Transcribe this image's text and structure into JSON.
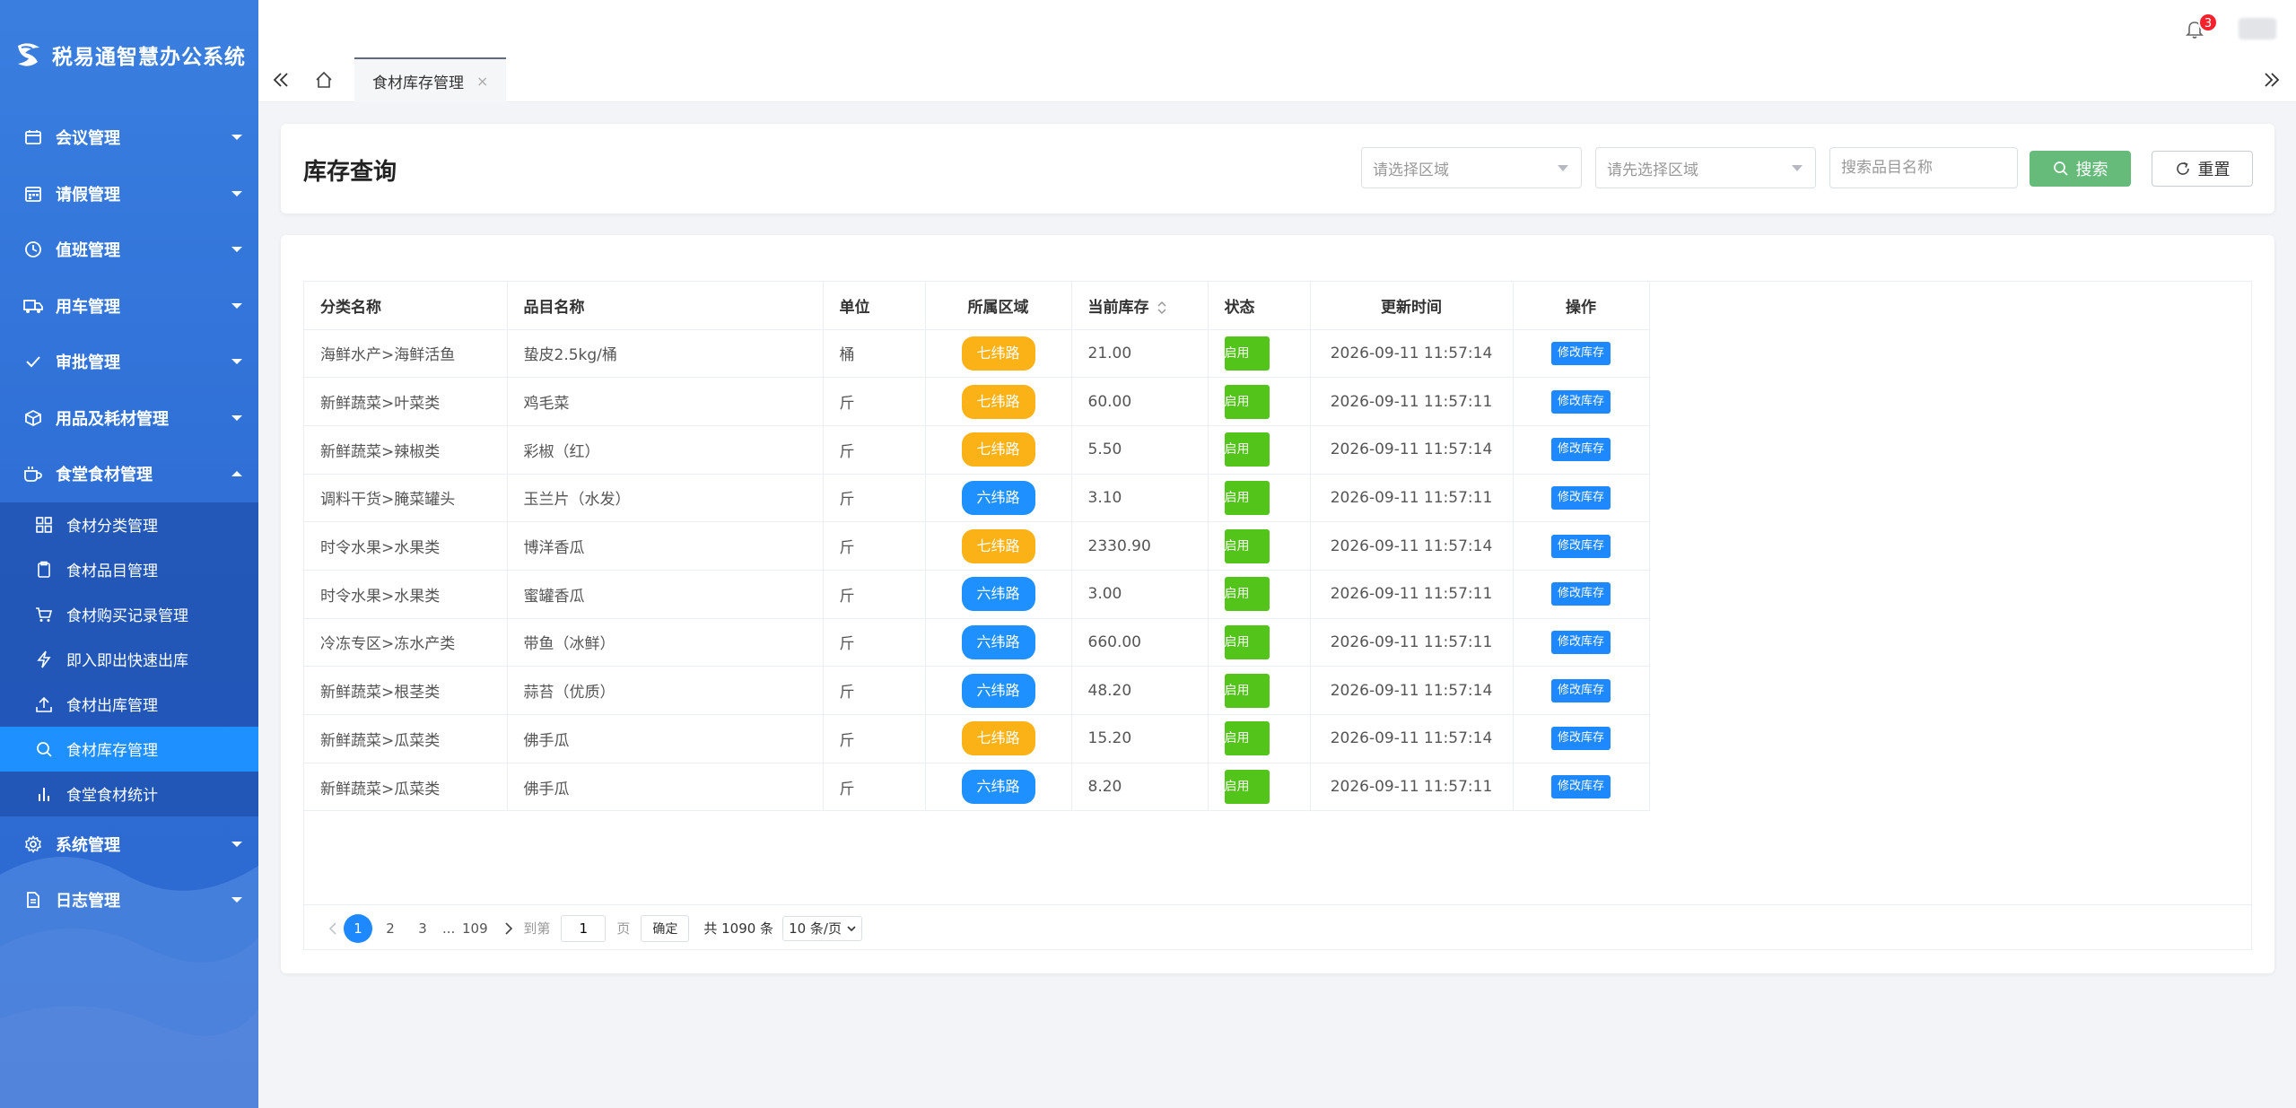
{
  "app": {
    "title": "税易通智慧办公系统"
  },
  "sidebar": {
    "menu": [
      {
        "label": "会议管理",
        "icon": "calendar-icon"
      },
      {
        "label": "请假管理",
        "icon": "calendar-grid-icon"
      },
      {
        "label": "值班管理",
        "icon": "clock-icon"
      },
      {
        "label": "用车管理",
        "icon": "truck-icon"
      },
      {
        "label": "审批管理",
        "icon": "check-icon"
      },
      {
        "label": "用品及耗材管理",
        "icon": "box-icon"
      },
      {
        "label": "食堂食材管理",
        "icon": "cup-icon"
      }
    ],
    "submenu": [
      {
        "label": "食材分类管理",
        "icon": "grid-icon"
      },
      {
        "label": "食材品目管理",
        "icon": "clipboard-icon"
      },
      {
        "label": "食材购买记录管理",
        "icon": "cart-icon"
      },
      {
        "label": "即入即出快速出库",
        "icon": "lightning-icon"
      },
      {
        "label": "食材出库管理",
        "icon": "upload-icon"
      },
      {
        "label": "食材库存管理",
        "icon": "search-icon"
      },
      {
        "label": "食堂食材统计",
        "icon": "bar-chart-icon"
      }
    ],
    "menu_after": [
      {
        "label": "系统管理",
        "icon": "gear-icon"
      },
      {
        "label": "日志管理",
        "icon": "document-icon"
      }
    ]
  },
  "header": {
    "notification_count": "3"
  },
  "tabs": {
    "active_tab": "食材库存管理",
    "close": "×"
  },
  "search": {
    "title": "库存查询",
    "area_placeholder": "请选择区域",
    "sub_area_placeholder": "请先选择区域",
    "keyword_placeholder": "搜索品目名称",
    "search_label": "搜索",
    "reset_label": "重置"
  },
  "table": {
    "columns": [
      "分类名称",
      "品目名称",
      "单位",
      "所属区域",
      "当前库存",
      "状态",
      "更新时间",
      "操作"
    ],
    "area_colors": {
      "七纬路": "#fbb217",
      "六纬路": "#1e90ff"
    },
    "rows": [
      {
        "category": "海鲜水产>海鲜活鱼",
        "item": "蛰皮2.5kg/桶",
        "unit": "桶",
        "area": "七纬路",
        "stock": "21.00",
        "status": "启用",
        "updated": "2026-09-11 11:57:14",
        "action": "修改库存"
      },
      {
        "category": "新鲜蔬菜>叶菜类",
        "item": "鸡毛菜",
        "unit": "斤",
        "area": "七纬路",
        "stock": "60.00",
        "status": "启用",
        "updated": "2026-09-11 11:57:11",
        "action": "修改库存"
      },
      {
        "category": "新鲜蔬菜>辣椒类",
        "item": "彩椒（红）",
        "unit": "斤",
        "area": "七纬路",
        "stock": "5.50",
        "status": "启用",
        "updated": "2026-09-11 11:57:14",
        "action": "修改库存"
      },
      {
        "category": "调料干货>腌菜罐头",
        "item": "玉兰片（水发）",
        "unit": "斤",
        "area": "六纬路",
        "stock": "3.10",
        "status": "启用",
        "updated": "2026-09-11 11:57:11",
        "action": "修改库存"
      },
      {
        "category": "时令水果>水果类",
        "item": "博洋香瓜",
        "unit": "斤",
        "area": "七纬路",
        "stock": "2330.90",
        "status": "启用",
        "updated": "2026-09-11 11:57:14",
        "action": "修改库存"
      },
      {
        "category": "时令水果>水果类",
        "item": "蜜罐香瓜",
        "unit": "斤",
        "area": "六纬路",
        "stock": "3.00",
        "status": "启用",
        "updated": "2026-09-11 11:57:11",
        "action": "修改库存"
      },
      {
        "category": "冷冻专区>冻水产类",
        "item": "带鱼（冰鲜）",
        "unit": "斤",
        "area": "六纬路",
        "stock": "660.00",
        "status": "启用",
        "updated": "2026-09-11 11:57:11",
        "action": "修改库存"
      },
      {
        "category": "新鲜蔬菜>根茎类",
        "item": "蒜苔（优质）",
        "unit": "斤",
        "area": "六纬路",
        "stock": "48.20",
        "status": "启用",
        "updated": "2026-09-11 11:57:14",
        "action": "修改库存"
      },
      {
        "category": "新鲜蔬菜>瓜菜类",
        "item": "佛手瓜",
        "unit": "斤",
        "area": "七纬路",
        "stock": "15.20",
        "status": "启用",
        "updated": "2026-09-11 11:57:14",
        "action": "修改库存"
      },
      {
        "category": "新鲜蔬菜>瓜菜类",
        "item": "佛手瓜",
        "unit": "斤",
        "area": "六纬路",
        "stock": "8.20",
        "status": "启用",
        "updated": "2026-09-11 11:57:11",
        "action": "修改库存"
      }
    ]
  },
  "pagination": {
    "pages": [
      "1",
      "2",
      "3"
    ],
    "ellipsis": "...",
    "last_page": "109",
    "goto_label": "到第",
    "goto_value": "1",
    "page_suffix": "页",
    "confirm_label": "确定",
    "total_text": "共 1090 条",
    "page_size": "10 条/页"
  }
}
